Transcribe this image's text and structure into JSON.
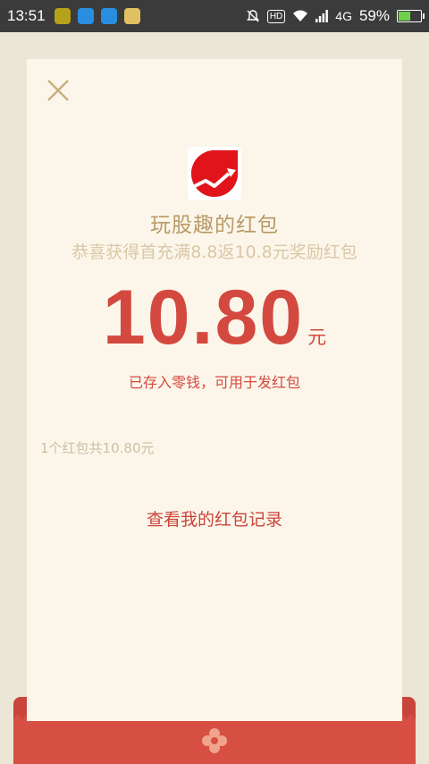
{
  "status_bar": {
    "time": "13:51",
    "network": "4G",
    "battery": "59%",
    "battery_level": 0.59,
    "hd_label": "HD",
    "app_icons": [
      {
        "name": "app-icon-1",
        "color": "#b6a11a"
      },
      {
        "name": "app-icon-2",
        "color": "#2a8ee0"
      },
      {
        "name": "app-icon-3",
        "color": "#2a8ee0"
      },
      {
        "name": "app-icon-4",
        "color": "#e0c060"
      }
    ]
  },
  "card": {
    "title": "玩股趣的红包",
    "subtitle": "恭喜获得首充满8.8返10.8元奖励红包",
    "amount": "10.80",
    "unit": "元",
    "stored_notice": "已存入零钱，可用于发红包",
    "packet_count": "1个红包共10.80元",
    "record_link": "查看我的红包记录"
  },
  "colors": {
    "accent_red": "#d4493f",
    "gold": "#b89a66",
    "card_bg": "#fcf6ea",
    "page_bg": "#ece6d6"
  },
  "icons": {
    "close": "close-icon",
    "logo": "stock-chart-logo-icon",
    "envelope": "flower-icon"
  }
}
